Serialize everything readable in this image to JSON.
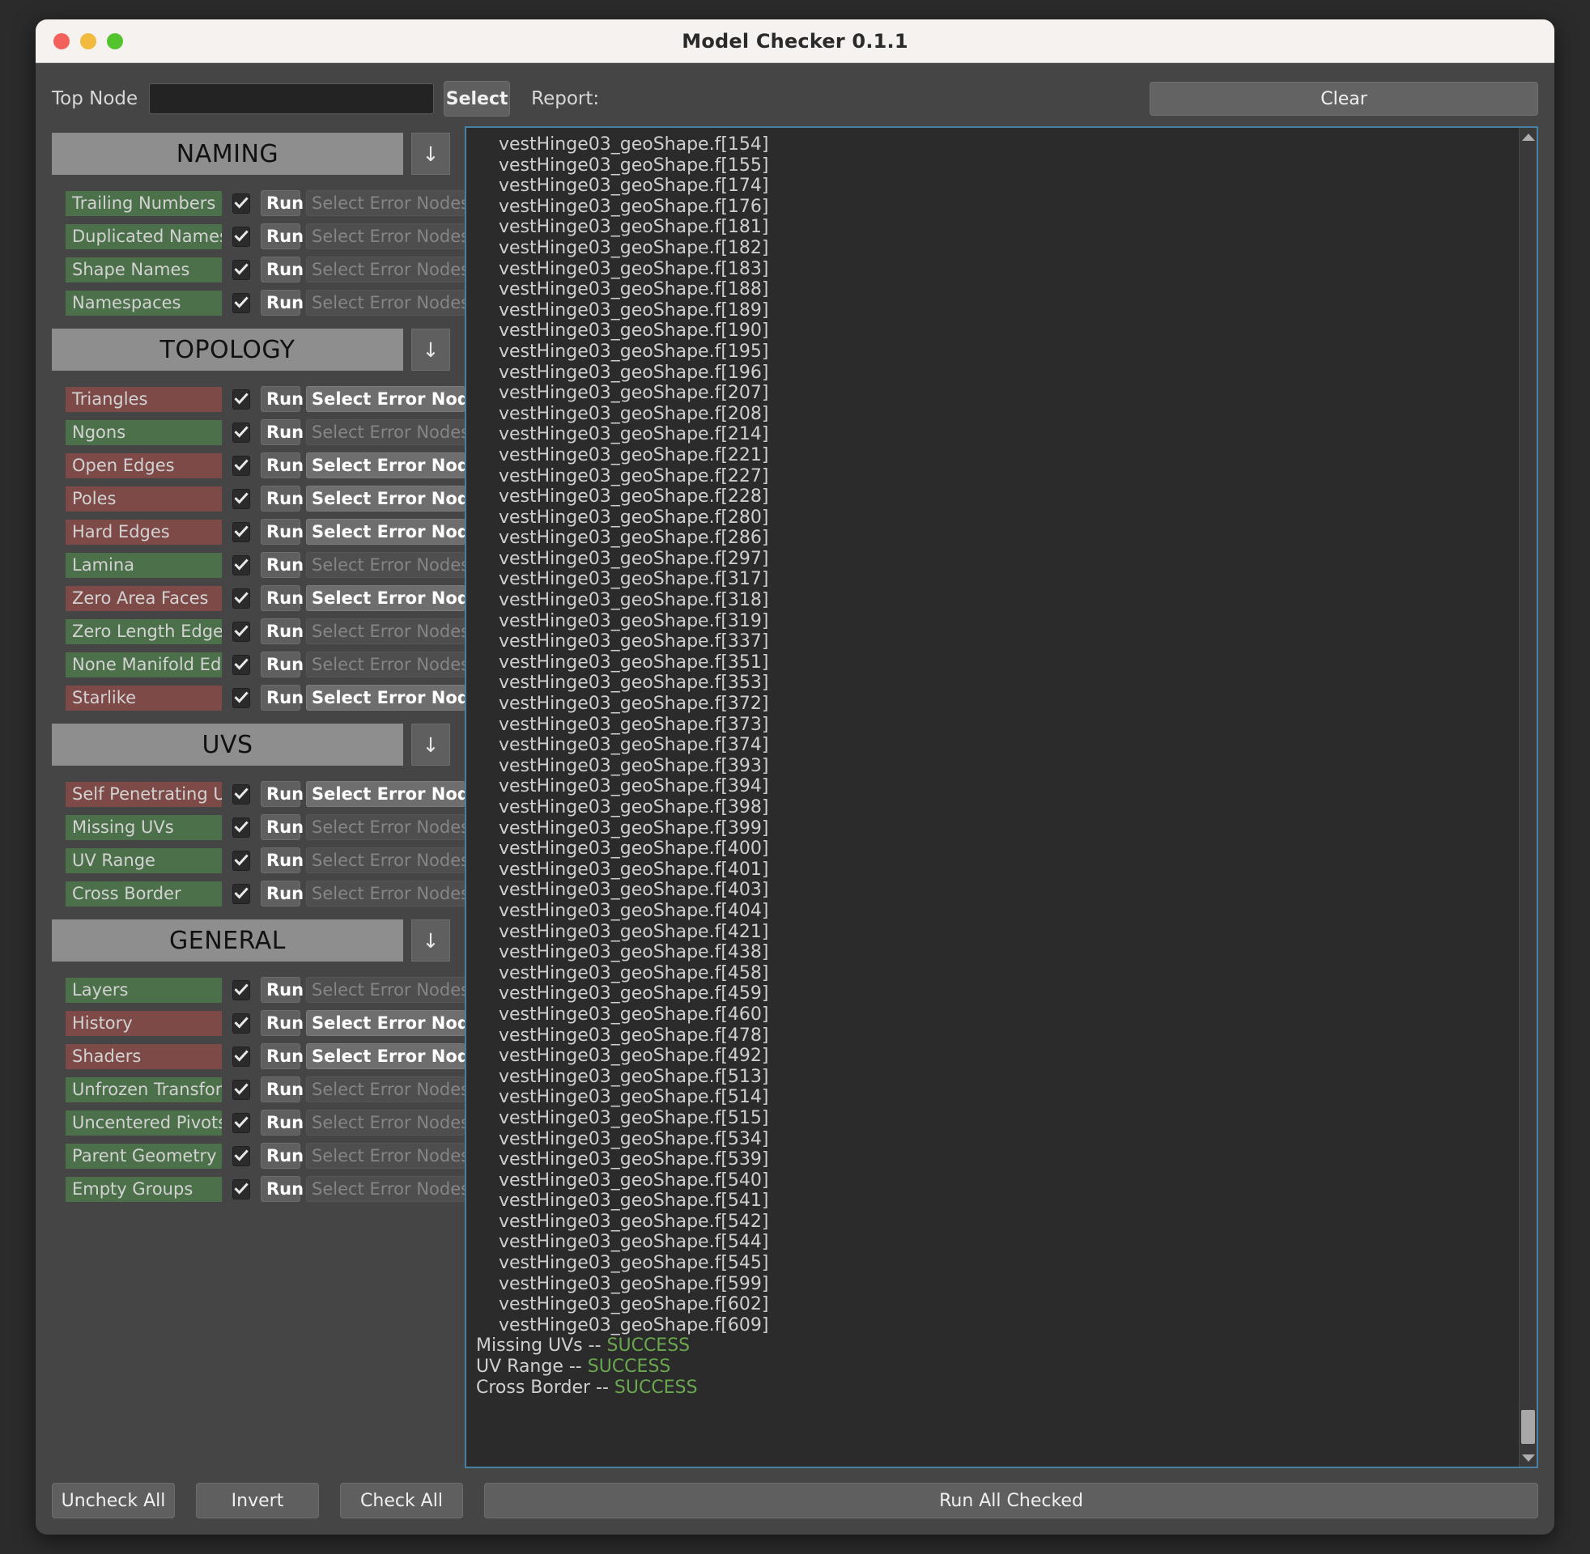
{
  "window": {
    "title": "Model Checker 0.1.1",
    "traffic_lights": [
      "close",
      "minimize",
      "zoom"
    ]
  },
  "toolbar": {
    "top_node_label": "Top Node",
    "top_node_value": "",
    "top_node_placeholder": "",
    "select_label": "Select",
    "report_label": "Report:",
    "clear_label": "Clear"
  },
  "labels": {
    "run": "Run",
    "select_error_nodes": "Select Error Nodes",
    "collapse_arrow": "↓",
    "checkmark": "✓"
  },
  "categories": [
    {
      "name": "NAMING",
      "checks": [
        {
          "label": "Trailing Numbers",
          "status": "pass",
          "checked": true,
          "select_enabled": false
        },
        {
          "label": "Duplicated Names",
          "status": "pass",
          "checked": true,
          "select_enabled": false
        },
        {
          "label": "Shape Names",
          "status": "pass",
          "checked": true,
          "select_enabled": false
        },
        {
          "label": "Namespaces",
          "status": "pass",
          "checked": true,
          "select_enabled": false
        }
      ]
    },
    {
      "name": "TOPOLOGY",
      "checks": [
        {
          "label": "Triangles",
          "status": "fail",
          "checked": true,
          "select_enabled": true
        },
        {
          "label": "Ngons",
          "status": "pass",
          "checked": true,
          "select_enabled": false
        },
        {
          "label": "Open Edges",
          "status": "fail",
          "checked": true,
          "select_enabled": true
        },
        {
          "label": "Poles",
          "status": "fail",
          "checked": true,
          "select_enabled": true
        },
        {
          "label": "Hard Edges",
          "status": "fail",
          "checked": true,
          "select_enabled": true
        },
        {
          "label": "Lamina",
          "status": "pass",
          "checked": true,
          "select_enabled": false
        },
        {
          "label": "Zero Area Faces",
          "status": "fail",
          "checked": true,
          "select_enabled": true
        },
        {
          "label": "Zero Length Edges",
          "status": "pass",
          "checked": true,
          "select_enabled": false
        },
        {
          "label": "None Manifold Edges",
          "status": "pass",
          "checked": true,
          "select_enabled": false
        },
        {
          "label": "Starlike",
          "status": "fail",
          "checked": true,
          "select_enabled": true
        }
      ]
    },
    {
      "name": "UVS",
      "checks": [
        {
          "label": "Self Penetrating UVs",
          "status": "fail",
          "checked": true,
          "select_enabled": true
        },
        {
          "label": "Missing UVs",
          "status": "pass",
          "checked": true,
          "select_enabled": false
        },
        {
          "label": "UV Range",
          "status": "pass",
          "checked": true,
          "select_enabled": false
        },
        {
          "label": "Cross Border",
          "status": "pass",
          "checked": true,
          "select_enabled": false
        }
      ]
    },
    {
      "name": "GENERAL",
      "checks": [
        {
          "label": "Layers",
          "status": "pass",
          "checked": true,
          "select_enabled": false
        },
        {
          "label": "History",
          "status": "fail",
          "checked": true,
          "select_enabled": true
        },
        {
          "label": "Shaders",
          "status": "fail",
          "checked": true,
          "select_enabled": true
        },
        {
          "label": "Unfrozen Transforms",
          "status": "pass",
          "checked": true,
          "select_enabled": false
        },
        {
          "label": "Uncentered Pivots",
          "status": "pass",
          "checked": true,
          "select_enabled": false
        },
        {
          "label": "Parent Geometry",
          "status": "pass",
          "checked": true,
          "select_enabled": false
        },
        {
          "label": "Empty Groups",
          "status": "pass",
          "checked": true,
          "select_enabled": false
        }
      ]
    }
  ],
  "report": {
    "node_prefix": "vestHinge03_geoShape.f[",
    "node_suffix": "]",
    "face_indices": [
      154,
      155,
      174,
      176,
      181,
      182,
      183,
      188,
      189,
      190,
      195,
      196,
      207,
      208,
      214,
      221,
      227,
      228,
      280,
      286,
      297,
      317,
      318,
      319,
      337,
      351,
      353,
      372,
      373,
      374,
      393,
      394,
      398,
      399,
      400,
      401,
      403,
      404,
      421,
      438,
      458,
      459,
      460,
      478,
      492,
      513,
      514,
      515,
      534,
      539,
      540,
      541,
      542,
      544,
      545,
      599,
      602,
      609
    ],
    "results": [
      {
        "name": "Missing UVs",
        "separator": " -- ",
        "status": "SUCCESS"
      },
      {
        "name": "UV Range",
        "separator": " -- ",
        "status": "SUCCESS"
      },
      {
        "name": "Cross Border",
        "separator": " -- ",
        "status": "SUCCESS"
      }
    ],
    "scroll_up_icon": "triangle-up",
    "scroll_down_icon": "triangle-down"
  },
  "footer": {
    "uncheck_all": "Uncheck All",
    "invert": "Invert",
    "check_all": "Check All",
    "run_all_checked": "Run All Checked"
  },
  "colors": {
    "pass": "#4c7049",
    "fail": "#7d4a48",
    "success_text": "#6aa84f",
    "panel": "#454545",
    "report_bg": "#2b2b2b",
    "report_border": "#4a7fa5",
    "category_header": "#8e8e8e"
  }
}
